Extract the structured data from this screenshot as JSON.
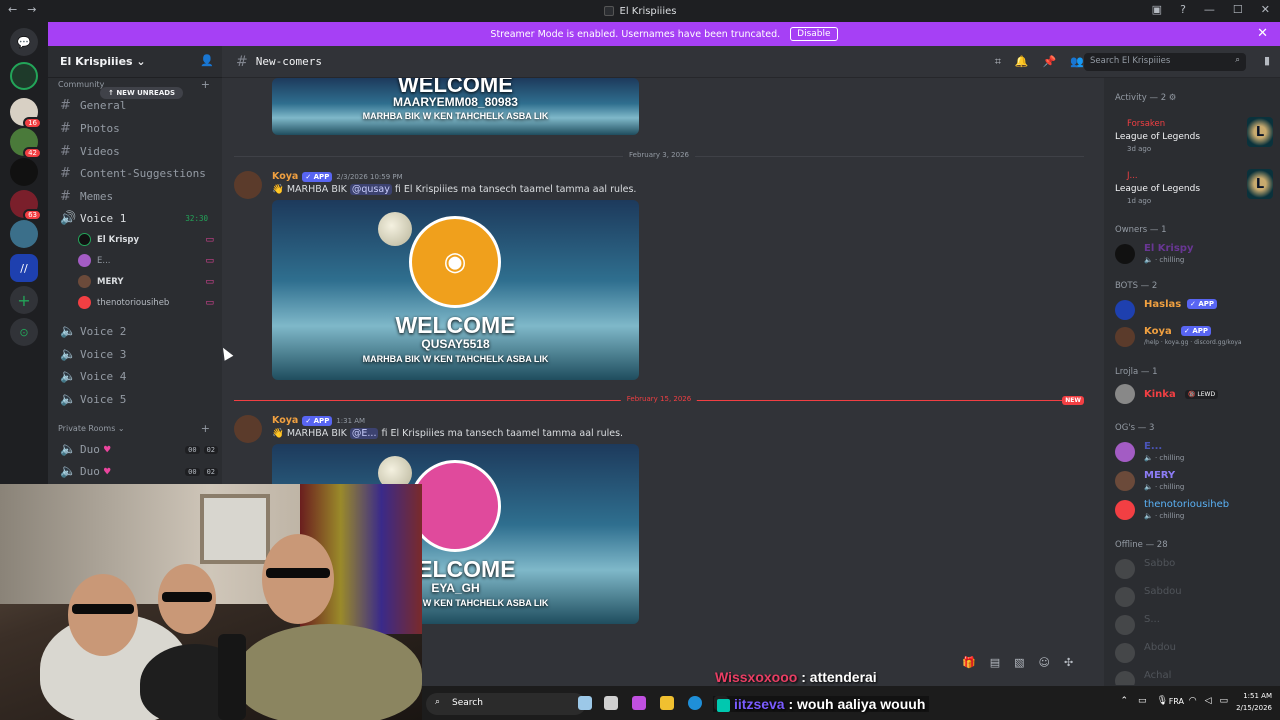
{
  "window": {
    "title": "El Krispiiies"
  },
  "banner": {
    "text": "Streamer Mode is enabled. Usernames have been truncated.",
    "button": "Disable"
  },
  "servers": [
    {
      "name": "direct-messages-icon"
    },
    {
      "name": "server-1"
    },
    {
      "name": "server-2",
      "badge": "16"
    },
    {
      "name": "server-3",
      "badge": "42"
    },
    {
      "name": "server-4"
    },
    {
      "name": "server-5",
      "badge": "63"
    },
    {
      "name": "server-6"
    },
    {
      "name": "server-7"
    }
  ],
  "sidebar": {
    "server_name": "El Krispiiies",
    "category_community": "Community",
    "new_unreads": "NEW UNREADS",
    "channels": [
      {
        "label": "General"
      },
      {
        "label": "Photos"
      },
      {
        "label": "Videos"
      },
      {
        "label": "Content-Suggestions"
      },
      {
        "label": "Memes"
      }
    ],
    "voice_active": {
      "label": "Voice 1",
      "timer": "32:30"
    },
    "voice_users": [
      {
        "label": "El Krispy"
      },
      {
        "label": "E..."
      },
      {
        "label": "MERY"
      },
      {
        "label": "thenotoriousiheb"
      }
    ],
    "voice_channels": [
      {
        "label": "Voice 2"
      },
      {
        "label": "Voice 3"
      },
      {
        "label": "Voice 4"
      },
      {
        "label": "Voice 5"
      }
    ],
    "category_private": "Private Rooms",
    "private_rooms": [
      {
        "label": "Duo",
        "a": "00",
        "b": "02"
      },
      {
        "label": "Duo",
        "a": "00",
        "b": "02"
      }
    ]
  },
  "chat": {
    "channel": "New-comers",
    "search_placeholder": "Search El Krispiiies",
    "welcome0": {
      "title": "WELCOME",
      "user": "MAARYEMM08_80983",
      "sub": "MARHBA BIK W KEN TAHCHELK ASBA LIK"
    },
    "divider1": "February 3, 2026",
    "msg1": {
      "author": "Koya",
      "tag": "APP",
      "time": "2/3/2026 10:59 PM",
      "pre": "👋 MARHBA BIK ",
      "mention": "@qusay",
      "post": " fi El Krispiiies ma tansech taamel tamma aal rules."
    },
    "welcome1": {
      "title": "WELCOME",
      "user": "QUSAY5518",
      "sub": "MARHBA BIK W KEN TAHCHELK ASBA LIK"
    },
    "divider2": "February 15, 2026",
    "new_tag": "NEW",
    "msg2": {
      "author": "Koya",
      "tag": "APP",
      "time": "1:31 AM",
      "pre": "👋 MARHBA BIK ",
      "mention": "@E...",
      "post": " fi El Krispiiies ma tansech taamel tamma aal rules."
    },
    "welcome2": {
      "title": "WELCOME",
      "user": "EYA_GH",
      "sub": "MARHBA BIK W KEN TAHCHELK ASBA LIK"
    }
  },
  "members": {
    "activity_header": "Activity — 2",
    "activity": [
      {
        "name": "Forsaken",
        "game": "League of Legends",
        "ago": "3d ago"
      },
      {
        "name": "J...",
        "game": "League of Legends",
        "ago": "1d ago"
      }
    ],
    "owners_header": "Owners — 1",
    "owners": [
      {
        "name": "El Krispy",
        "status": "chilling"
      }
    ],
    "bots_header": "BOTS — 2",
    "bots": [
      {
        "name": "Haslas",
        "tag": "APP",
        "status": ""
      },
      {
        "name": "Koya",
        "tag": "APP",
        "status": "/help · koya.gg · discord.gg/koya"
      }
    ],
    "lrojla_header": "Lrojla — 1",
    "lrojla": [
      {
        "name": "Kinka",
        "tag": "LEWD"
      }
    ],
    "ogs_header": "OG's — 3",
    "ogs": [
      {
        "name": "E...",
        "status": "chilling"
      },
      {
        "name": "MERY",
        "status": "chilling"
      },
      {
        "name": "thenotoriousiheb",
        "status": "chilling"
      }
    ],
    "offline_header": "Offline — 28",
    "offline": [
      {
        "name": "Sabbo"
      },
      {
        "name": "Sabdou"
      },
      {
        "name": "S..."
      },
      {
        "name": "Abdou"
      },
      {
        "name": "Achal"
      }
    ]
  },
  "taskbar": {
    "search": "Search",
    "lang": "FRA",
    "time": "1:51 AM",
    "date": "2/15/2026"
  },
  "overlay": {
    "line1_user": "Wissxoxooo",
    "line1_msg": ": attenderai",
    "line2_user": "iitzseva",
    "line2_msg": ": wouh aaliya wouuh"
  },
  "colors": {
    "banner": "#a640f5",
    "accent": "#5865f2",
    "koya": "#f0a040",
    "unread": "#f23f43"
  }
}
